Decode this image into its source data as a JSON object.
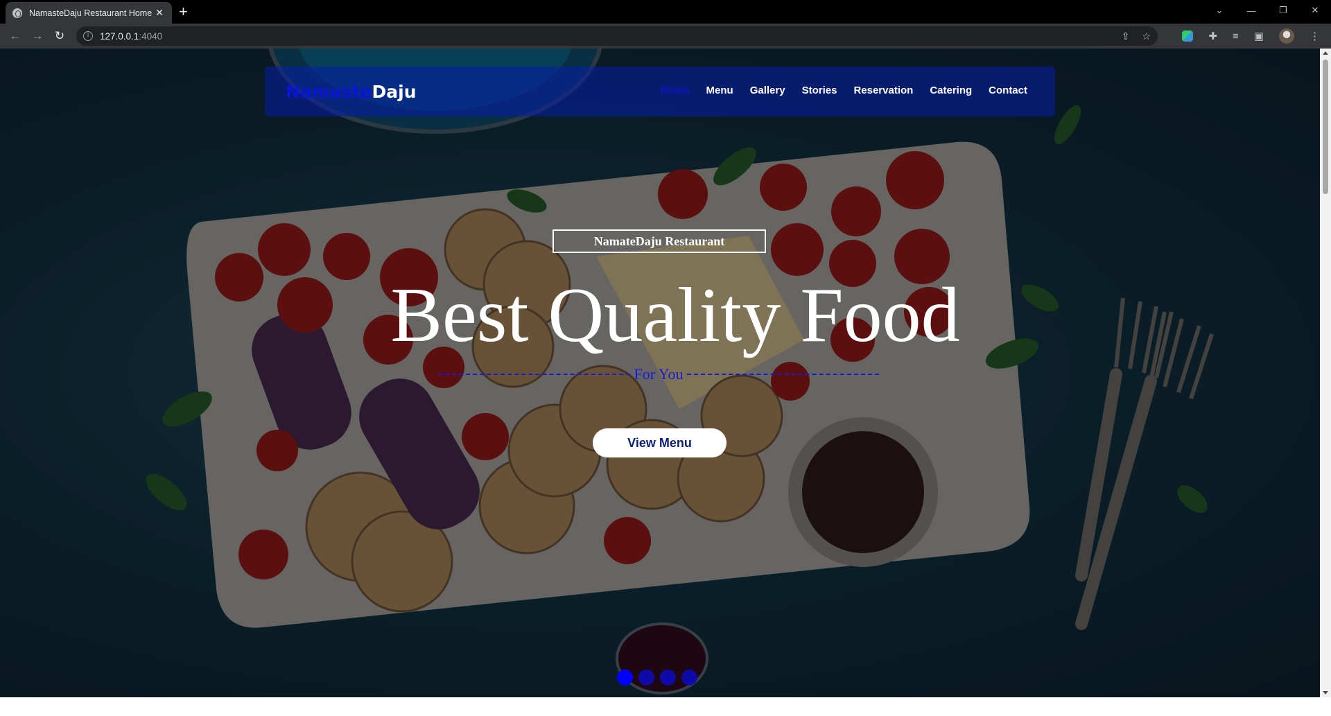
{
  "browser": {
    "tab_title": "NamasteDaju Restaurant Home",
    "url_host": "127.0.0.1",
    "url_port": ":4040"
  },
  "nav": {
    "brand_part1": "Namaste",
    "brand_part2": "Daju",
    "items": [
      "Home",
      "Menu",
      "Gallery",
      "Stories",
      "Reservation",
      "Catering",
      "Contact"
    ],
    "active_item": "Home"
  },
  "hero": {
    "subtitle": "NamateDaju Restaurant",
    "headline": "Best Quality Food",
    "tagline": "For You",
    "cta_label": "View Menu",
    "slide_count": 4,
    "active_slide": 1
  },
  "colors": {
    "nav_bg": "#051eaa",
    "brand_accent": "#0a14d8",
    "active_link": "#1010c8",
    "tagline": "#1818e0",
    "dot": "#0b0bb8"
  }
}
